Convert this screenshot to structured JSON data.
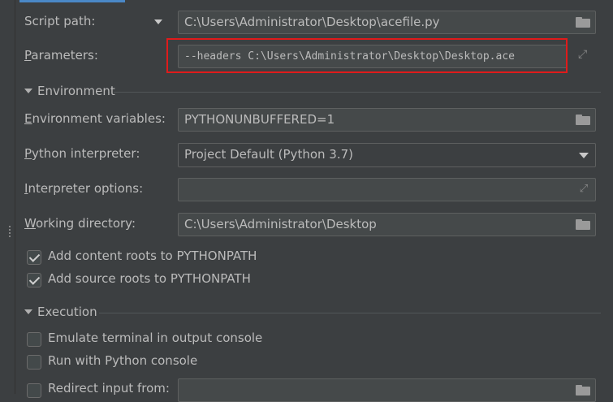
{
  "fields": {
    "script_path": {
      "label": "Script path:",
      "value": "C:\\Users\\Administrator\\Desktop\\acefile.py"
    },
    "parameters": {
      "label_mn": "P",
      "label_rest": "arameters:",
      "value": "--headers C:\\Users\\Administrator\\Desktop\\Desktop.ace"
    },
    "env_vars": {
      "label_mn": "E",
      "label_rest": "nvironment variables:",
      "value": "PYTHONUNBUFFERED=1"
    },
    "interpreter": {
      "label_mn": "P",
      "label_rest": "ython interpreter:",
      "value": "Project Default (Python 3.7)"
    },
    "interpreter_options": {
      "label_mn": "I",
      "label_rest": "nterpreter options:",
      "value": ""
    },
    "working_dir": {
      "label_mn": "W",
      "label_rest": "orking directory:",
      "value": "C:\\Users\\Administrator\\Desktop"
    },
    "redirect_input": {
      "label": "Redirect input from:",
      "value": ""
    }
  },
  "sections": {
    "environment": "Environment",
    "execution": "Execution"
  },
  "checkboxes": {
    "content_roots": {
      "label": "Add content roots to PYTHONPATH",
      "checked": true
    },
    "source_roots": {
      "label": "Add source roots to PYTHONPATH",
      "checked": true
    },
    "emulate_terminal": {
      "label": "Emulate terminal in output console",
      "checked": false
    },
    "python_console": {
      "label": "Run with Python console",
      "checked": false
    },
    "redirect_input": {
      "checked": false
    }
  },
  "icons": {
    "folder": "folder-icon",
    "expand": "expand-icon",
    "dropdown": "chevron-down-icon"
  },
  "colors": {
    "background": "#3c3f41",
    "field_bg": "#45494a",
    "text": "#bbbbbb",
    "highlight": "#e01b1b",
    "accent": "#4a88c7"
  }
}
